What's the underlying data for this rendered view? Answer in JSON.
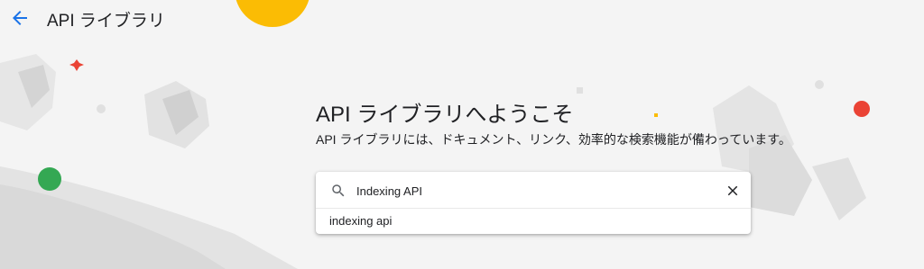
{
  "header": {
    "title": "API ライブラリ",
    "back_icon": "arrow-back-icon"
  },
  "welcome": {
    "title": "API ライブラリへようこそ",
    "subtitle": "API ライブラリには、ドキュメント、リンク、効率的な検索機能が備わっています。"
  },
  "search": {
    "value": "Indexing API",
    "icon": "search-icon",
    "clear_icon": "close-icon",
    "suggestions": [
      "indexing api"
    ]
  },
  "colors": {
    "accent_blue": "#1a73e8",
    "yellow": "#fbbc04",
    "red": "#ea4335",
    "green": "#34a853"
  }
}
